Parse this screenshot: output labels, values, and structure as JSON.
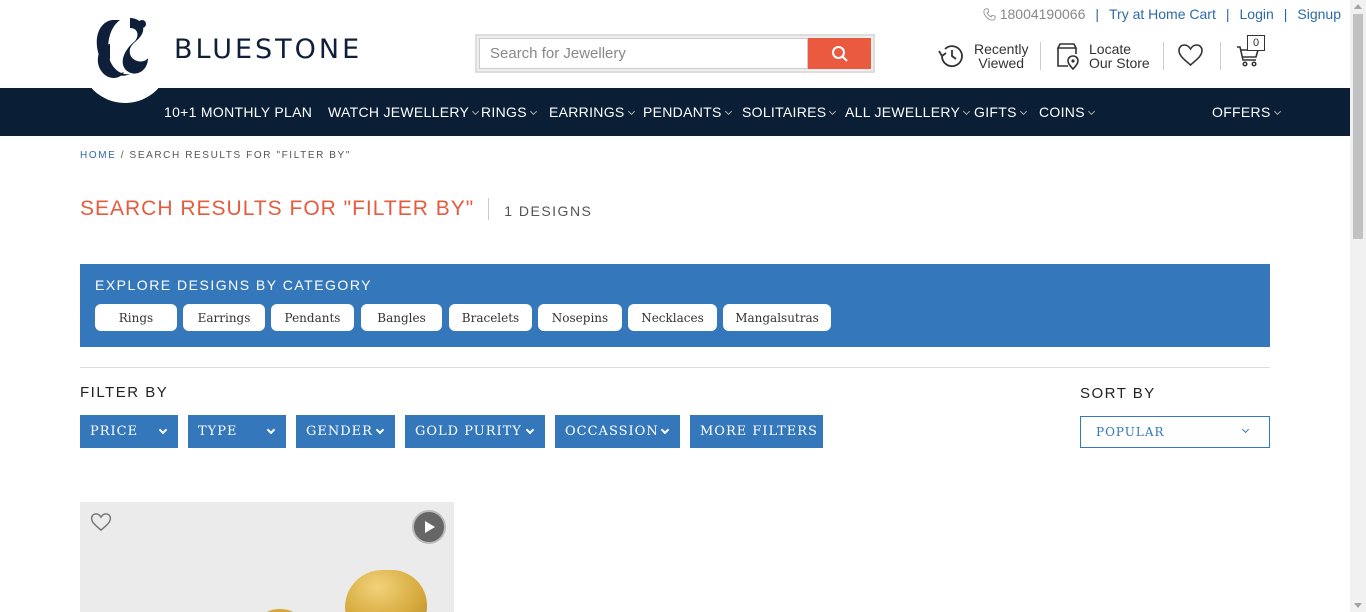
{
  "header": {
    "brand": "BLUESTONE",
    "phone": "18004190066",
    "links": [
      "Try at Home Cart",
      "Login",
      "Signup"
    ],
    "search_placeholder": "Search for Jewellery",
    "recently_viewed": [
      "Recently",
      "Viewed"
    ],
    "locate_store": [
      "Locate",
      "Our Store"
    ],
    "cart_count": "0"
  },
  "nav": {
    "items": [
      "10+1 MONTHLY PLAN",
      "WATCH JEWELLERY",
      "RINGS",
      "EARRINGS",
      "PENDANTS",
      "SOLITAIRES",
      "ALL JEWELLERY",
      "GIFTS",
      "COINS",
      "OFFERS"
    ]
  },
  "breadcrumb": {
    "home": "HOME",
    "current": "/ SEARCH RESULTS FOR \"FILTER BY\""
  },
  "results": {
    "title": "SEARCH RESULTS FOR \"FILTER BY\"",
    "count": "1 DESIGNS"
  },
  "categories": {
    "title": "EXPLORE DESIGNS BY CATEGORY",
    "items": [
      "Rings",
      "Earrings",
      "Pendants",
      "Bangles",
      "Bracelets",
      "Nosepins",
      "Necklaces",
      "Mangalsutras"
    ]
  },
  "filters": {
    "label": "FILTER BY",
    "buttons": [
      "PRICE",
      "TYPE",
      "GENDER",
      "GOLD PURITY",
      "OCCASSION",
      "MORE FILTERS"
    ]
  },
  "sort": {
    "label": "SORT BY",
    "selected": "POPULAR"
  },
  "colors": {
    "navy": "#0a1f36",
    "accent": "#ea5a3e",
    "blue": "#3477bb"
  }
}
